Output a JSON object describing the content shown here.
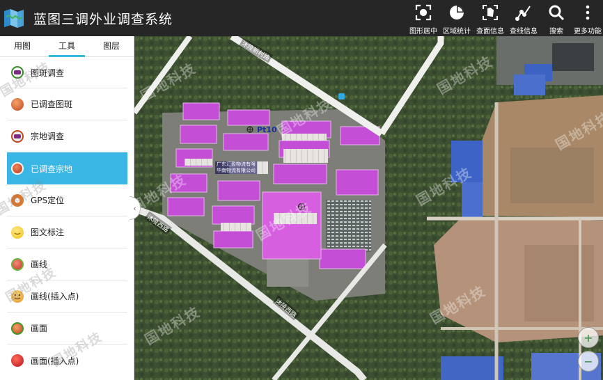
{
  "app": {
    "title": "蓝图三调外业调查系统",
    "icon": "folded-map-icon"
  },
  "toolbar": {
    "actions": [
      {
        "id": "center",
        "label": "图形居中",
        "icon": "focus-frame-icon"
      },
      {
        "id": "stats",
        "label": "区域统计",
        "icon": "pie-chart-icon"
      },
      {
        "id": "query",
        "label": "查面信息",
        "icon": "area-select-icon"
      },
      {
        "id": "line",
        "label": "查线信息",
        "icon": "polyline-icon"
      },
      {
        "id": "search",
        "label": "搜索",
        "icon": "search-icon"
      },
      {
        "id": "more",
        "label": "更多功能",
        "icon": "more-vertical-icon"
      }
    ]
  },
  "panel": {
    "tabs": [
      {
        "label": "用图",
        "active": false
      },
      {
        "label": "工具",
        "active": true
      },
      {
        "label": "图层",
        "active": false
      }
    ],
    "tools": [
      {
        "label": "图斑调查",
        "icon": "parcel-survey-icon",
        "color": "#3a8a2a",
        "active": false
      },
      {
        "label": "已调查图斑",
        "icon": "surveyed-parcel-icon",
        "color": "#d2541f",
        "active": false
      },
      {
        "label": "宗地调查",
        "icon": "land-survey-icon",
        "color": "#7a2b7d",
        "active": false
      },
      {
        "label": "已调查宗地",
        "icon": "surveyed-land-icon",
        "color": "#c0461c",
        "active": true
      },
      {
        "label": "GPS定位",
        "icon": "gps-icon",
        "color": "#e0782a",
        "active": false
      },
      {
        "label": "图文标注",
        "icon": "annotation-icon",
        "color": "#f0c419",
        "active": false
      },
      {
        "label": "画线",
        "icon": "draw-line-icon",
        "color": "#c0392b",
        "active": false
      },
      {
        "label": "画线(插入点)",
        "icon": "draw-line-insert-icon",
        "color": "#f0b52a",
        "active": false
      },
      {
        "label": "画面",
        "icon": "draw-polygon-icon",
        "color": "#3f9a2a",
        "active": false
      },
      {
        "label": "画面(插入点)",
        "icon": "draw-polygon-insert-icon",
        "color": "#c0241c",
        "active": false
      }
    ]
  },
  "map": {
    "point_label": "Pt10",
    "company_label_1": "广东汇盈物流有限",
    "company_label_2": "华南物流有限公司",
    "road_top": "沐陵新村路",
    "road_left": "沐陵西路",
    "road_bottom": "沐陵西路",
    "watermark": "国地科技",
    "highlight_color": "#c44fd6",
    "zoom_in": "+",
    "zoom_out": "−"
  }
}
